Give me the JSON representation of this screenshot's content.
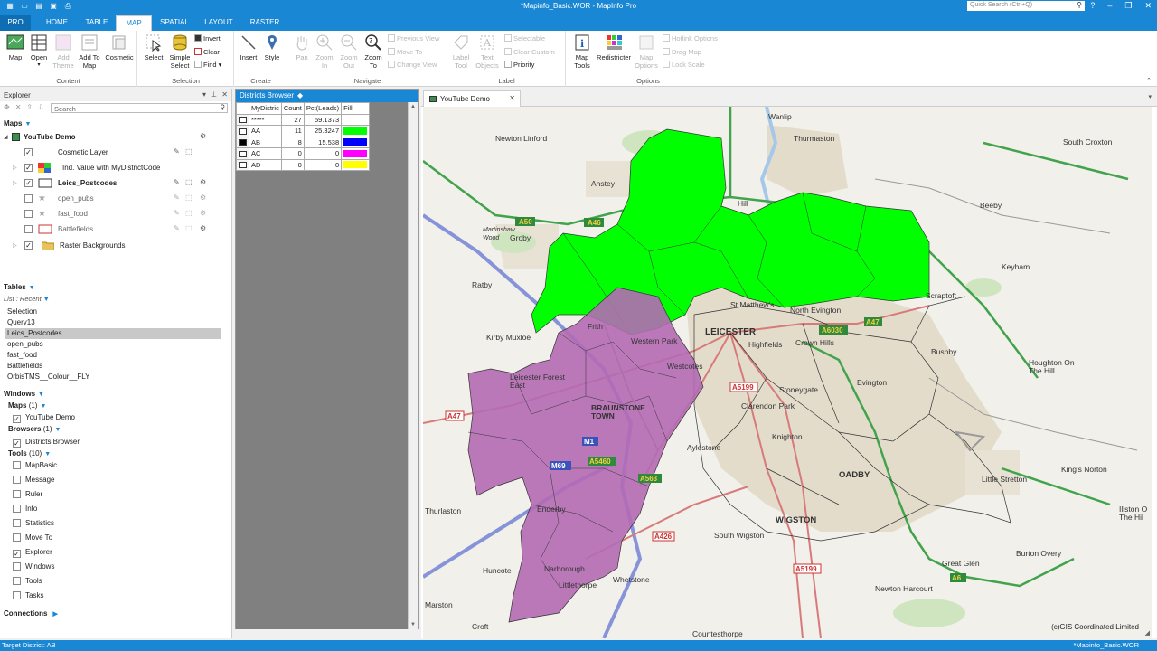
{
  "window": {
    "title": "*Mapinfo_Basic.WOR - MapInfo Pro",
    "quick_search_placeholder": "Quick Search (Ctrl+Q)"
  },
  "ribbon_tabs": [
    "PRO",
    "HOME",
    "TABLE",
    "MAP",
    "SPATIAL",
    "LAYOUT",
    "RASTER"
  ],
  "active_tab": "MAP",
  "ribbon": {
    "content": {
      "label": "Content",
      "map": "Map",
      "open": "Open",
      "add_theme": "Add\nTheme",
      "add_to_map": "Add To\nMap",
      "cosmetic": "Cosmetic"
    },
    "selection": {
      "label": "Selection",
      "select": "Select",
      "simple_select": "Simple\nSelect",
      "invert": "Invert",
      "clear": "Clear",
      "find": "Find"
    },
    "create": {
      "label": "Create",
      "insert": "Insert",
      "style": "Style"
    },
    "navigate": {
      "label": "Navigate",
      "pan": "Pan",
      "zoom_in": "Zoom\nIn",
      "zoom_out": "Zoom\nOut",
      "zoom_to": "Zoom\nTo",
      "previous_view": "Previous View",
      "move_to": "Move To",
      "change_view": "Change View"
    },
    "label": {
      "label": "Label",
      "label_tool": "Label\nTool",
      "text_objects": "Text\nObjects",
      "selectable": "Selectable",
      "clear_custom": "Clear Custom",
      "priority": "Priority"
    },
    "options": {
      "label": "Options",
      "map_tools": "Map\nTools",
      "redistricter": "Redistricter",
      "map_options": "Map\nOptions",
      "hotlink_options": "Hotlink Options",
      "drag_map": "Drag Map",
      "lock_scale": "Lock Scale"
    }
  },
  "explorer": {
    "title": "Explorer",
    "search_placeholder": "Search",
    "maps_header": "Maps",
    "map_name": "YouTube Demo",
    "layers": [
      {
        "name": "Cosmetic Layer",
        "checked": true
      },
      {
        "name": "Ind. Value with MyDistrictCode",
        "checked": true
      },
      {
        "name": "Leics_Postcodes",
        "checked": true
      },
      {
        "name": "open_pubs",
        "checked": false
      },
      {
        "name": "fast_food",
        "checked": false
      },
      {
        "name": "Battlefields",
        "checked": false
      },
      {
        "name": "Raster Backgrounds",
        "checked": true
      }
    ],
    "tables_header": "Tables",
    "tables_list_mode": "List : Recent",
    "tables": [
      "Selection",
      "Query13",
      "Leics_Postcodes",
      "open_pubs",
      "fast_food",
      "Battlefields",
      "OrbisTMS__Colour__FLY"
    ],
    "selected_table": "Leics_Postcodes",
    "windows_header": "Windows",
    "windows_maps": "Maps",
    "windows_maps_count": "(1)",
    "windows_map_item": "YouTube Demo",
    "windows_browsers": "Browsers",
    "windows_browsers_count": "(1)",
    "windows_browser_item": "Districts Browser",
    "windows_tools": "Tools",
    "windows_tools_count": "(10)",
    "tools": [
      {
        "name": "MapBasic",
        "checked": false
      },
      {
        "name": "Message",
        "checked": false
      },
      {
        "name": "Ruler",
        "checked": false
      },
      {
        "name": "Info",
        "checked": false
      },
      {
        "name": "Statistics",
        "checked": false
      },
      {
        "name": "Move To",
        "checked": false
      },
      {
        "name": "Explorer",
        "checked": true
      },
      {
        "name": "Windows",
        "checked": false
      },
      {
        "name": "Tools",
        "checked": false
      },
      {
        "name": "Tasks",
        "checked": false
      }
    ],
    "connections_header": "Connections"
  },
  "browser": {
    "title": "Districts Browser",
    "columns": [
      "MyDistric",
      "Count",
      "Pct(Leads)",
      "Fill"
    ],
    "rows": [
      {
        "district": "*****",
        "count": "27",
        "pct": "59.1373",
        "fill": "#ffffff",
        "selected": false
      },
      {
        "district": "AA",
        "count": "11",
        "pct": "25.3247",
        "fill": "#00ff00",
        "selected": false
      },
      {
        "district": "AB",
        "count": "8",
        "pct": "15.538",
        "fill": "#0000ff",
        "selected": true
      },
      {
        "district": "AC",
        "count": "0",
        "pct": "0",
        "fill": "#ff00ff",
        "selected": false
      },
      {
        "district": "AD",
        "count": "0",
        "pct": "0",
        "fill": "#ffff00",
        "selected": false
      }
    ]
  },
  "map_window": {
    "tab": "YouTube Demo",
    "copyright": "(c)GIS Coordinated Limited",
    "colors": {
      "district_aa": "#00ff00",
      "district_ab": "#b46ab4"
    },
    "places": {
      "newton_linford": "Newton Linford",
      "wanlip": "Wanlip",
      "south_croxton": "South Croxton",
      "anstey": "Anstey",
      "thurmaston": "Thurmaston",
      "beeby": "Beeby",
      "groby": "Groby",
      "martinshaw_wood": "Martinshaw\nWood",
      "hill": "Hill",
      "ratby": "Ratby",
      "keyham": "Keyham",
      "scraptoft": "Scraptoft",
      "frith": "Frith",
      "st_matthews": "St Matthew's",
      "north_evington": "North Evington",
      "leicester": "LEICESTER",
      "kirby_muxloe": "Kirby Muxloe",
      "western_park": "Western Park",
      "highfields": "Highfields",
      "crown_hills": "Crown Hills",
      "bushby": "Bushby",
      "houghton_on_the_hill": "Houghton On\nThe Hill",
      "leicester_forest_east": "Leicester Forest\nEast",
      "westcotes": "Westcotes",
      "stoneygate": "Stoneygate",
      "evington": "Evington",
      "braunstone_town": "BRAUNSTONE\nTOWN",
      "clarendon_park": "Clarendon Park",
      "knighton": "Knighton",
      "aylestone": "Aylestone",
      "oadby": "OADBY",
      "thurlaston": "Thurlaston",
      "enderby": "Enderby",
      "wigston": "WIGSTON",
      "little_stretton": "Little Stretton",
      "kings_norton": "King's Norton",
      "illston_on_the_hill": "Illston O\nThe Hil",
      "south_wigston": "South Wigston",
      "narborough": "Narborough",
      "littlethorpe": "Littlethorpe",
      "huncote": "Huncote",
      "whetstone": "Whetstone",
      "burton_overy": "Burton Overy",
      "great_glen": "Great Glen",
      "newton_harcourt": "Newton Harcourt",
      "marston": "Marston",
      "croft": "Croft",
      "countesthorpe": "Countesthorpe"
    },
    "roads": {
      "a50": "A50",
      "a46": "A46",
      "a6030": "A6030",
      "a47": "A47",
      "a5199": "A5199",
      "m1": "M1",
      "m69": "M69",
      "a5460": "A5460",
      "a563": "A563",
      "a426": "A426",
      "a6": "A6",
      "a5199b": "A5199",
      "a47b": "A47"
    }
  },
  "status_bar": {
    "left": "Target District: AB",
    "right": "*Mapinfo_Basic.WOR"
  }
}
